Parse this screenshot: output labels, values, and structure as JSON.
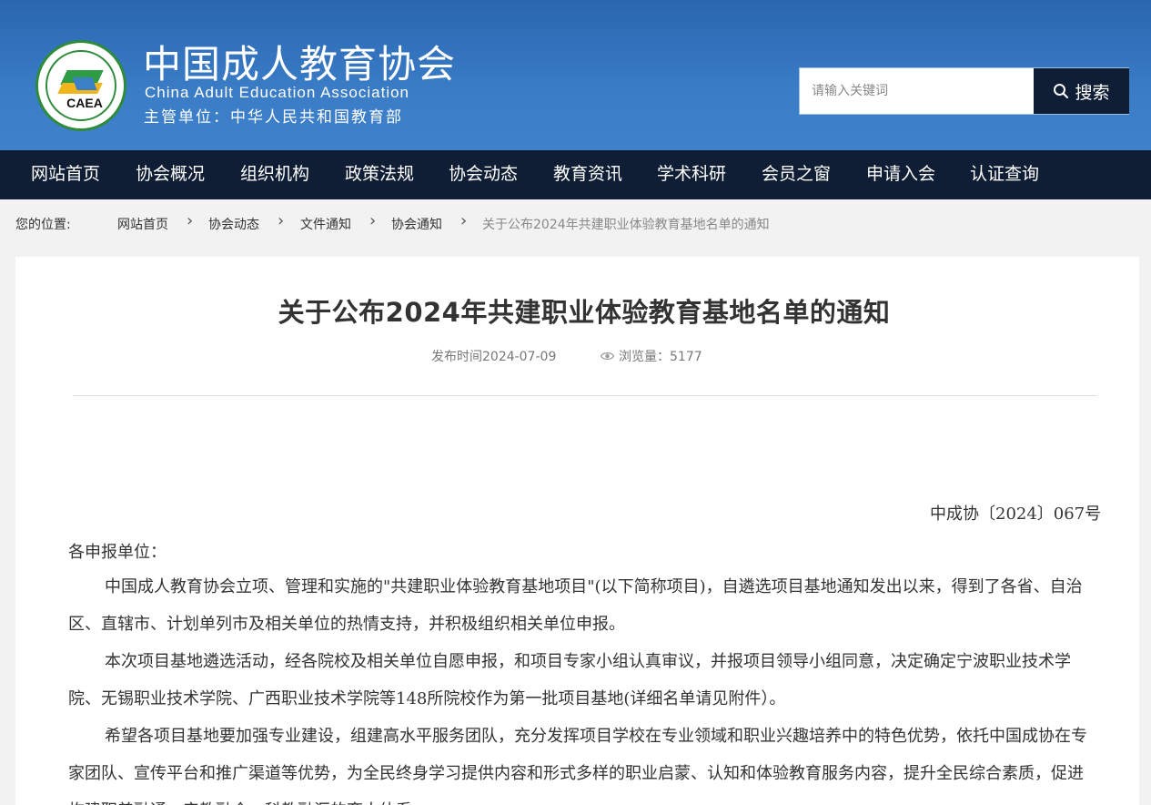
{
  "header": {
    "logo_text": "CAEA",
    "logo_ring_text": "CHINA ADULT EDUCATION ASSOCIATION",
    "title": "中国成人教育协会",
    "subtitle": "China Adult Education Association",
    "authority": "主管单位：中华人民共和国教育部",
    "colors": {
      "header_blue": "#3a7cc6",
      "nav_dark": "#0f1e34"
    }
  },
  "search": {
    "placeholder": "请输入关键词",
    "button_label": "搜索",
    "icon": "search-icon"
  },
  "nav": {
    "items": [
      {
        "label": "网站首页"
      },
      {
        "label": "协会概况"
      },
      {
        "label": "组织机构"
      },
      {
        "label": "政策法规"
      },
      {
        "label": "协会动态"
      },
      {
        "label": "教育资讯"
      },
      {
        "label": "学术科研"
      },
      {
        "label": "会员之窗"
      },
      {
        "label": "申请入会"
      },
      {
        "label": "认证查询"
      }
    ]
  },
  "breadcrumb": {
    "label": "您的位置:",
    "items": [
      {
        "label": "网站首页"
      },
      {
        "label": "协会动态"
      },
      {
        "label": "文件通知"
      },
      {
        "label": "协会通知"
      }
    ],
    "current": "关于公布2024年共建职业体验教育基地名单的通知",
    "separator_icon": "chevron-right-icon"
  },
  "article": {
    "title": "关于公布2024年共建职业体验教育基地名单的通知",
    "publish_time": "发布时间2024-07-09",
    "views": "浏览量：5177",
    "views_icon": "eye-icon",
    "doc_number": "中成协〔2024〕067号",
    "greeting": "各申报单位：",
    "paragraphs": [
      "中国成人教育协会立项、管理和实施的\"共建职业体验教育基地项目\"(以下简称项目)，自遴选项目基地通知发出以来，得到了各省、自治区、直辖市、计划单列市及相关单位的热情支持，并积极组织相关单位申报。",
      "本次项目基地遴选活动，经各院校及相关单位自愿申报，和项目专家小组认真审议，并报项目领导小组同意，决定确定宁波职业技术学院、无锡职业技术学院、广西职业技术学院等148所院校作为第一批项目基地(详细名单请见附件）。",
      "希望各项目基地要加强专业建设，组建高水平服务团队，充分发挥项目学校在专业领域和职业兴趣培养中的特色优势，依托中国成协在专家团队、宣传平台和推广渠道等优势，为全民终身学习提供内容和形式多样的职业启蒙、认知和体验教育服务内容，提升全民综合素质，促进构建职普融通、产教融合、科教融汇的育人体系。"
    ]
  }
}
